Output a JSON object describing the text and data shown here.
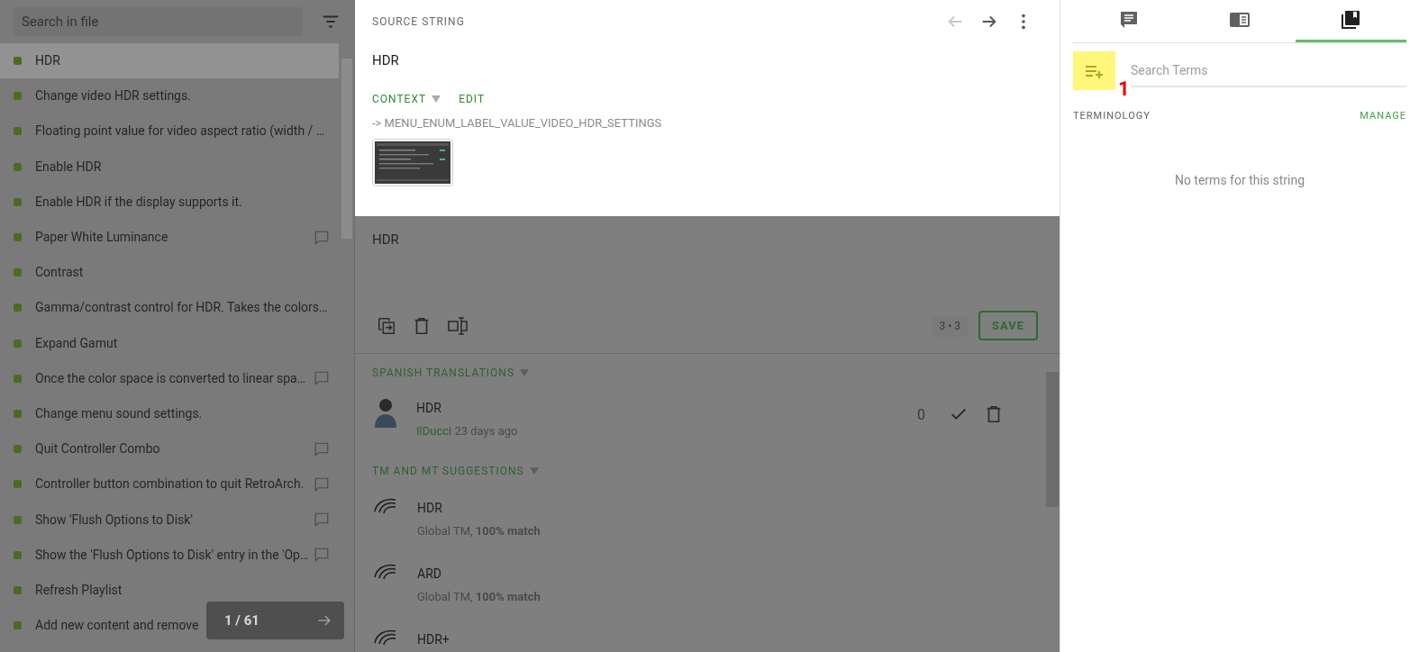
{
  "file_list": {
    "search": {
      "placeholder": "Search in file"
    },
    "rows": [
      {
        "text": "HDR",
        "selected": true,
        "has_comment": false
      },
      {
        "text": "Change video HDR settings.",
        "selected": false,
        "has_comment": false
      },
      {
        "text": "Floating point value for video aspect ratio (width / …",
        "selected": false,
        "has_comment": false
      },
      {
        "text": "Enable HDR",
        "selected": false,
        "has_comment": false
      },
      {
        "text": "Enable HDR if the display supports it.",
        "selected": false,
        "has_comment": false
      },
      {
        "text": "Paper White Luminance",
        "selected": false,
        "has_comment": true
      },
      {
        "text": "Contrast",
        "selected": false,
        "has_comment": false
      },
      {
        "text": "Gamma/contrast control for HDR. Takes the colors…",
        "selected": false,
        "has_comment": false
      },
      {
        "text": "Expand Gamut",
        "selected": false,
        "has_comment": false
      },
      {
        "text": "Once the color space is converted to linear spa…",
        "selected": false,
        "has_comment": true
      },
      {
        "text": "Change menu sound settings.",
        "selected": false,
        "has_comment": false
      },
      {
        "text": "Quit Controller Combo",
        "selected": false,
        "has_comment": true
      },
      {
        "text": "Controller button combination to quit RetroArch.",
        "selected": false,
        "has_comment": true
      },
      {
        "text": "Show 'Flush Options to Disk'",
        "selected": false,
        "has_comment": true
      },
      {
        "text": "Show the 'Flush Options to Disk' entry in the 'Op…",
        "selected": false,
        "has_comment": true
      },
      {
        "text": "Refresh Playlist",
        "selected": false,
        "has_comment": false
      },
      {
        "text": "Add new content and remove",
        "selected": false,
        "has_comment": false
      }
    ],
    "pager": {
      "text": "1 / 61"
    }
  },
  "source": {
    "heading": "SOURCE STRING",
    "text": "HDR",
    "context_label": "CONTEXT",
    "edit_label": "EDIT",
    "context": "-> MENU_ENUM_LABEL_VALUE_VIDEO_HDR_SETTINGS",
    "prev_disabled": true
  },
  "editor": {
    "value": "HDR",
    "counter": "3 • 3",
    "save": "SAVE"
  },
  "translations": {
    "heading": "SPANISH TRANSLATIONS",
    "items": [
      {
        "text": "HDR",
        "author": "IlDucci",
        "time": "23 days ago",
        "votes": "0"
      }
    ]
  },
  "suggestions": {
    "heading": "TM AND MT SUGGESTIONS",
    "items": [
      {
        "text": "HDR",
        "source": "Global TM, ",
        "match": "100% match"
      },
      {
        "text": "ARD",
        "source": "Global TM, ",
        "match": "100% match"
      },
      {
        "text": "HDR+"
      }
    ]
  },
  "side": {
    "tabs": [
      {
        "kind": "comments",
        "selected": false
      },
      {
        "kind": "glossary",
        "selected": false
      },
      {
        "kind": "terms",
        "selected": true
      }
    ],
    "search": {
      "placeholder": "Search Terms"
    },
    "marker": "1",
    "heading": "TERMINOLOGY",
    "manage": "MANAGE",
    "empty": "No terms for this string"
  }
}
